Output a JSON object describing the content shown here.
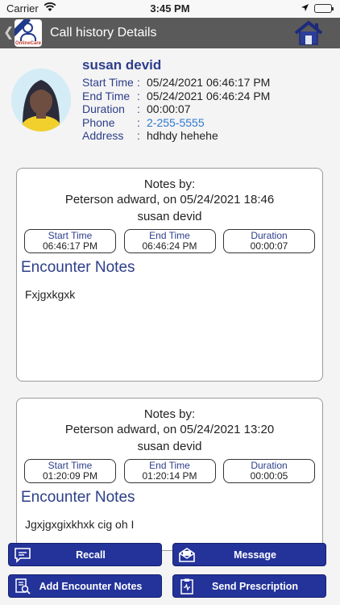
{
  "status_bar": {
    "carrier": "Carrier",
    "time": "3:45 PM"
  },
  "nav": {
    "title": "Call history Details",
    "logo_brand": "OnlineCare"
  },
  "patient": {
    "name": "susan devid",
    "fields": [
      {
        "label": "Start Time",
        "value": "05/24/2021 06:46:17 PM"
      },
      {
        "label": "End Time",
        "value": "05/24/2021 06:46:24 PM"
      },
      {
        "label": "Duration",
        "value": "00:00:07"
      },
      {
        "label": "Phone",
        "value": "2-255-5555"
      },
      {
        "label": "Address",
        "value": "hdhdy hehehe"
      }
    ],
    "separator": ":"
  },
  "notes": [
    {
      "notes_by": "Notes by:",
      "author": "Peterson adward, on 05/24/2021 18:46",
      "patient": "susan devid",
      "start_label": "Start Time",
      "start_value": "06:46:17 PM",
      "end_label": "End Time",
      "end_value": "06:46:24 PM",
      "duration_label": "Duration",
      "duration_value": "00:00:07",
      "encounter_title": "Encounter Notes",
      "encounter_text": "Fxjgxkgxk"
    },
    {
      "notes_by": "Notes by:",
      "author": "Peterson adward, on 05/24/2021 13:20",
      "patient": "susan devid",
      "start_label": "Start Time",
      "start_value": "01:20:09 PM",
      "end_label": "End Time",
      "end_value": "01:20:14 PM",
      "duration_label": "Duration",
      "duration_value": "00:00:05",
      "encounter_title": "Encounter Notes",
      "encounter_text": "Jgxjgxgixkhxk cig oh I"
    }
  ],
  "buttons": {
    "recall": "Recall",
    "message": "Message",
    "add_notes": "Add Encounter Notes",
    "send_prescription": "Send Prescription"
  },
  "colors": {
    "nav_bg": "#5a5a5a",
    "accent": "#2d3e8a",
    "button_bg": "#24339a",
    "link": "#2e78d0"
  }
}
